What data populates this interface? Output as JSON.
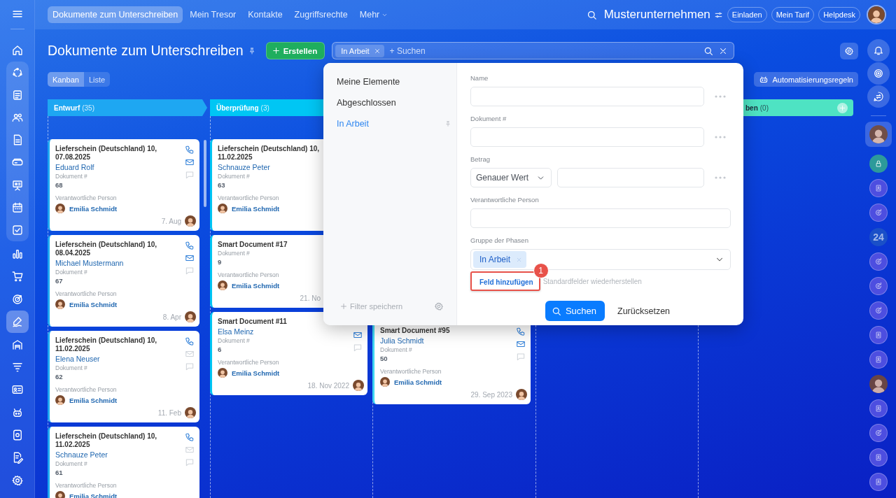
{
  "sidebar": {
    "top": [
      {
        "kind": "home",
        "selected": false
      }
    ],
    "group": [
      {
        "kind": "cycle",
        "selected": false
      },
      {
        "kind": "doclist",
        "selected": false
      },
      {
        "kind": "people",
        "selected": false
      },
      {
        "kind": "doc",
        "selected": false
      },
      {
        "kind": "drive",
        "selected": false
      },
      {
        "kind": "board",
        "selected": false
      },
      {
        "kind": "calendar",
        "selected": false
      },
      {
        "kind": "check",
        "selected": false
      }
    ],
    "items": [
      {
        "kind": "chart",
        "selected": false
      },
      {
        "kind": "cart",
        "selected": false
      },
      {
        "kind": "target",
        "selected": false
      },
      {
        "kind": "sign",
        "selected": true
      },
      {
        "kind": "garage",
        "selected": false
      },
      {
        "kind": "funnel",
        "selected": false
      },
      {
        "kind": "idcard",
        "selected": false
      },
      {
        "kind": "robot",
        "selected": false
      },
      {
        "kind": "device",
        "selected": false
      },
      {
        "kind": "docsign",
        "selected": false
      },
      {
        "kind": "gear",
        "selected": false
      }
    ]
  },
  "topbar": {
    "tabs": [
      {
        "label": "Dokumente zum Unterschreiben",
        "selected": true,
        "dropdown": false
      },
      {
        "label": "Mein Tresor",
        "selected": false,
        "dropdown": false
      },
      {
        "label": "Kontakte",
        "selected": false,
        "dropdown": false
      },
      {
        "label": "Zugriffsrechte",
        "selected": false,
        "dropdown": false
      },
      {
        "label": "Mehr",
        "selected": false,
        "dropdown": true
      }
    ],
    "company": "Musterunternehmen",
    "buttons": [
      "Einladen",
      "Mein Tarif",
      "Helpdesk"
    ]
  },
  "header": {
    "title": "Dokumente zum Unterschreiben",
    "create_button": "Erstellen",
    "search": {
      "chip": "In Arbeit",
      "placeholder": "+ Suchen"
    },
    "views": [
      {
        "label": "Kanban",
        "selected": true
      },
      {
        "label": "Liste",
        "selected": false
      }
    ],
    "automation_button": "Automatisierungsregeln"
  },
  "board": {
    "columns": [
      {
        "title": "Entwurf",
        "count": "(35)",
        "color": "#1ea7f2",
        "add_button": false,
        "cards": [
          {
            "title": "Lieferschein (Deutschland) 10, 07.08.2025",
            "contact": "Eduard Rolf",
            "field_label": "Dokument #",
            "number": "68",
            "person_label": "Verantwortliche Person",
            "person": "Emilia Schmidt",
            "date": "7. Aug",
            "avatar": true,
            "channels": [
              {
                "kind": "phone",
                "active": true
              },
              {
                "kind": "mail",
                "active": true
              },
              {
                "kind": "chat",
                "active": false
              }
            ]
          },
          {
            "title": "Lieferschein (Deutschland) 10, 08.04.2025",
            "contact": "Michael Mustermann",
            "field_label": "Dokument #",
            "number": "67",
            "person_label": "Verantwortliche Person",
            "person": "Emilia Schmidt",
            "date": "8. Apr",
            "avatar": true,
            "channels": [
              {
                "kind": "phone",
                "active": true
              },
              {
                "kind": "mail",
                "active": true
              },
              {
                "kind": "chat",
                "active": false
              }
            ]
          },
          {
            "title": "Lieferschein (Deutschland) 10, 11.02.2025",
            "contact": "Elena Neuser",
            "field_label": "Dokument #",
            "number": "62",
            "person_label": "Verantwortliche Person",
            "person": "Emilia Schmidt",
            "date": "11. Feb",
            "avatar": true,
            "channels": [
              {
                "kind": "phone",
                "active": true
              },
              {
                "kind": "mail",
                "active": false
              },
              {
                "kind": "chat",
                "active": false
              }
            ]
          },
          {
            "title": "Lieferschein (Deutschland) 10, 11.02.2025",
            "contact": "Schnauze Peter",
            "field_label": "Dokument #",
            "number": "61",
            "person_label": "Verantwortliche Person",
            "person": "Emilia Schmidt",
            "channels": [
              {
                "kind": "phone",
                "active": true
              },
              {
                "kind": "mail",
                "active": false
              },
              {
                "kind": "chat",
                "active": false
              }
            ]
          }
        ]
      },
      {
        "title": "Überprüfung",
        "count": "(3)",
        "color": "#00c6f4",
        "add_button": false,
        "cards": [
          {
            "title": "Lieferschein (Deutschland) 10, 11.02.2025",
            "contact": "Schnauze Peter",
            "field_label": "Dokument #",
            "number": "63",
            "person_label": "Verantwortliche Person",
            "person": "Emilia Schmidt"
          },
          {
            "title": "Smart Document #17",
            "field_label": "Dokument #",
            "number": "9",
            "person_label": "Verantwortliche Person",
            "person": "Emilia Schmidt",
            "date": "21. No",
            "avatar": false
          },
          {
            "title": "Smart Document #11",
            "contact": "Elsa Meinz",
            "field_label": "Dokument #",
            "number": "6",
            "person_label": "Verantwortliche Person",
            "person": "Emilia Schmidt",
            "date": "18. Nov 2022",
            "avatar": true,
            "channels": [
              {
                "kind": "mail",
                "active": true
              },
              {
                "kind": "chat",
                "active": false
              }
            ]
          }
        ]
      },
      {
        "color": "#3fd6f2",
        "cards": [
          {
            "title": "Smart Document #95",
            "contact": "Julia Schmidt",
            "field_label": "Dokument #",
            "number": "50",
            "person_label": "Verantwortliche Person",
            "person": "Emilia Schmidt",
            "date": "29. Sep 2023",
            "avatar": true,
            "channels": [
              {
                "kind": "phone",
                "active": true
              },
              {
                "kind": "mail",
                "active": true
              },
              {
                "kind": "chat",
                "active": false
              }
            ]
          }
        ]
      },
      {},
      {
        "title": "ben",
        "count": "(0)",
        "color": "#4ee3c3",
        "add_button": true
      }
    ]
  },
  "filter_popup": {
    "presets": [
      {
        "label": "Meine Elemente",
        "selected": false,
        "pinned": false
      },
      {
        "label": "Abgeschlossen",
        "selected": false,
        "pinned": false
      },
      {
        "label": "In Arbeit",
        "selected": true,
        "pinned": true
      }
    ],
    "save_filter": "Filter speichern",
    "fields": [
      {
        "kind": "text",
        "label": "Name",
        "menu": true
      },
      {
        "kind": "text",
        "label": "Dokument #",
        "menu": true
      },
      {
        "kind": "range",
        "label": "Betrag",
        "select": "Genauer Wert",
        "menu": true
      },
      {
        "kind": "text",
        "label": "Verantwortliche Person",
        "menu": false
      },
      {
        "kind": "tags",
        "label": "Gruppe der Phasen",
        "tags": [
          "In Arbeit"
        ],
        "menu": false
      }
    ],
    "add_field": "Feld hinzufügen",
    "restore": "Standardfelder wiederherstellen",
    "annotation_badge": "1",
    "search_button": "Suchen",
    "reset_button": "Zurücksetzen"
  },
  "right_rail": {
    "tools": [
      {
        "kind": "bell"
      },
      {
        "kind": "spiral"
      },
      {
        "kind": "chatswap"
      }
    ],
    "chats": [
      {
        "kind": "avatar",
        "selected": true
      },
      {
        "kind": "lock",
        "selected": false
      },
      {
        "kind": "contact",
        "selected": false
      },
      {
        "kind": "sync",
        "selected": false
      },
      {
        "kind": "text",
        "label": "24",
        "selected": false
      },
      {
        "kind": "sync",
        "selected": false
      },
      {
        "kind": "sync",
        "selected": false
      },
      {
        "kind": "sync",
        "selected": false
      },
      {
        "kind": "contact",
        "selected": false
      },
      {
        "kind": "contact",
        "selected": false
      },
      {
        "kind": "avatar",
        "selected": false
      },
      {
        "kind": "contact",
        "selected": false
      },
      {
        "kind": "sync",
        "selected": false
      },
      {
        "kind": "contact",
        "selected": false
      },
      {
        "kind": "contact",
        "selected": false
      }
    ]
  }
}
